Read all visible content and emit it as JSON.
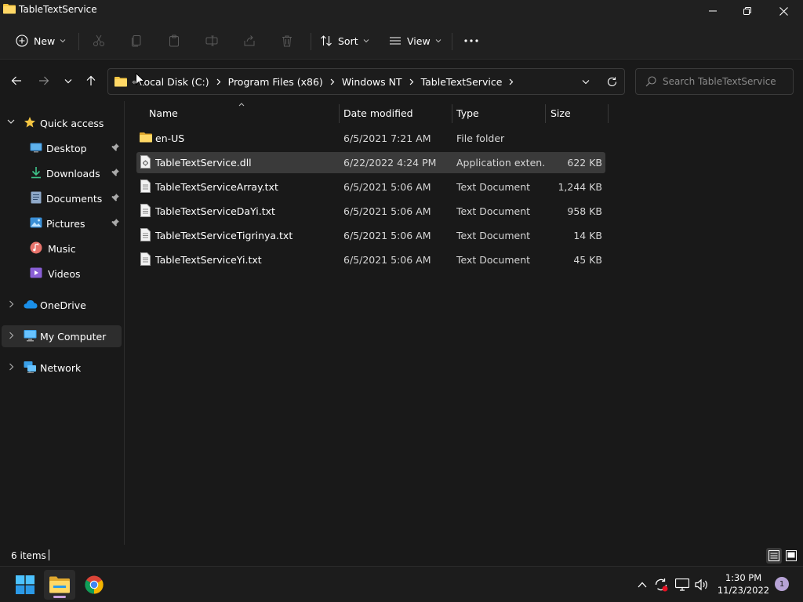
{
  "window": {
    "title": "TableTextService"
  },
  "command_bar": {
    "new_label": "New",
    "sort_label": "Sort",
    "view_label": "View"
  },
  "address_bar": {
    "overflow": "«",
    "crumbs": [
      "Local Disk (C:)",
      "Program Files (x86)",
      "Windows NT",
      "TableTextService"
    ]
  },
  "search": {
    "placeholder": "Search TableTextService"
  },
  "sidebar": {
    "quick_access": "Quick access",
    "items": [
      {
        "label": "Desktop"
      },
      {
        "label": "Downloads"
      },
      {
        "label": "Documents"
      },
      {
        "label": "Pictures"
      },
      {
        "label": "Music"
      },
      {
        "label": "Videos"
      }
    ],
    "onedrive": "OneDrive",
    "my_computer": "My Computer",
    "network": "Network"
  },
  "columns": {
    "name": "Name",
    "date": "Date modified",
    "type": "Type",
    "size": "Size"
  },
  "files": [
    {
      "name": "en-US",
      "date": "6/5/2021 7:21 AM",
      "type": "File folder",
      "size": "",
      "icon": "folder-icon"
    },
    {
      "name": "TableTextService.dll",
      "date": "6/22/2022 4:24 PM",
      "type": "Application exten...",
      "size": "622 KB",
      "icon": "dll-file-icon"
    },
    {
      "name": "TableTextServiceArray.txt",
      "date": "6/5/2021 5:06 AM",
      "type": "Text Document",
      "size": "1,244 KB",
      "icon": "text-file-icon"
    },
    {
      "name": "TableTextServiceDaYi.txt",
      "date": "6/5/2021 5:06 AM",
      "type": "Text Document",
      "size": "958 KB",
      "icon": "text-file-icon"
    },
    {
      "name": "TableTextServiceTigrinya.txt",
      "date": "6/5/2021 5:06 AM",
      "type": "Text Document",
      "size": "14 KB",
      "icon": "text-file-icon"
    },
    {
      "name": "TableTextServiceYi.txt",
      "date": "6/5/2021 5:06 AM",
      "type": "Text Document",
      "size": "45 KB",
      "icon": "text-file-icon"
    }
  ],
  "status": {
    "item_count": "6 items"
  },
  "taskbar": {
    "time": "1:30 PM",
    "date": "11/23/2022",
    "notification_count": "1"
  },
  "colors": {
    "background": "#191919",
    "chrome": "#202020",
    "selection": "#3a3a3a",
    "folder_yellow": "#f4c542",
    "accent_blue": "#4cc2ff"
  }
}
